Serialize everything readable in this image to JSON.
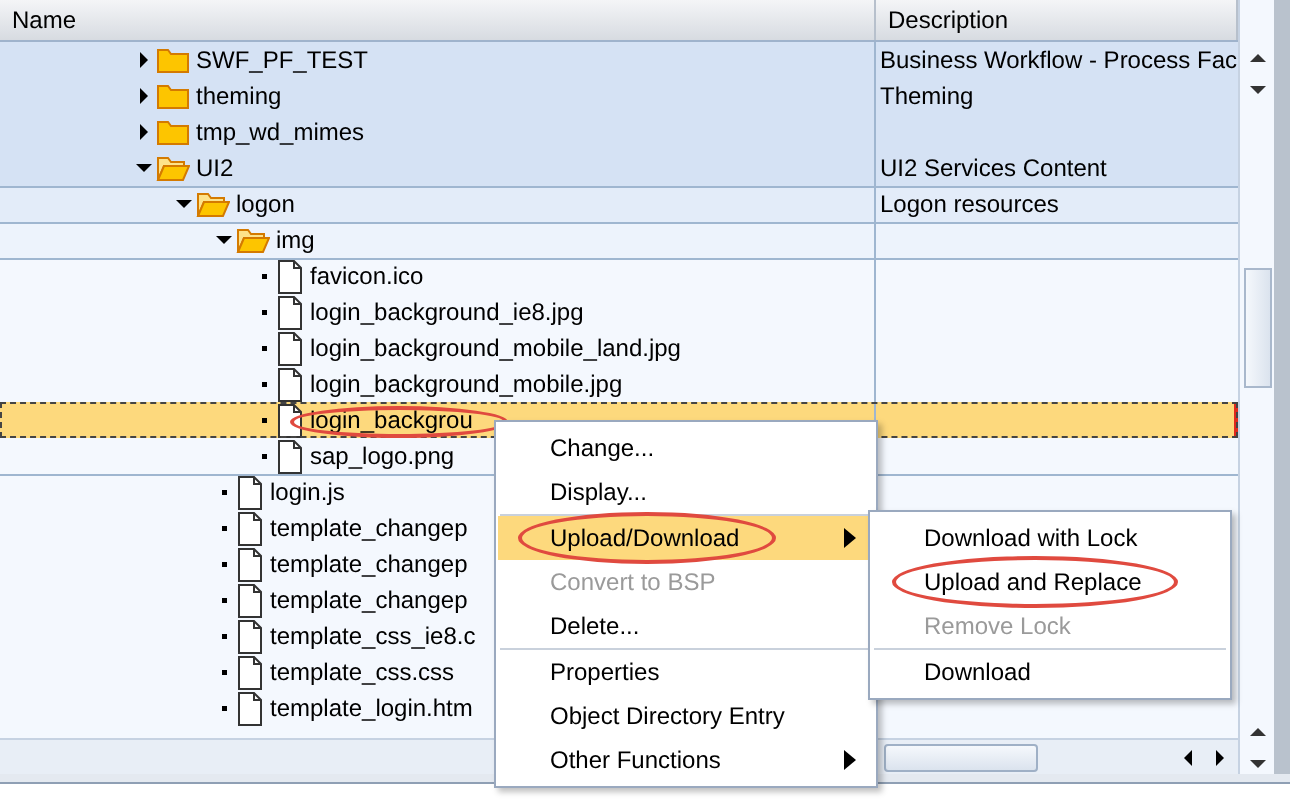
{
  "table": {
    "columns": [
      "Name",
      "Description"
    ]
  },
  "tree": {
    "items": [
      {
        "kind": "folder",
        "name": "SWF_PF_TEST",
        "description": "Business Workflow - Process Fac",
        "expanded": false,
        "selected": false,
        "circled": false
      },
      {
        "kind": "folder",
        "name": "theming",
        "description": "Theming",
        "expanded": false,
        "selected": false,
        "circled": false
      },
      {
        "kind": "folder",
        "name": "tmp_wd_mimes",
        "expanded": false,
        "selected": false,
        "circled": false
      },
      {
        "kind": "folder",
        "name": "UI2",
        "description": "UI2 Services Content",
        "expanded": true,
        "selected": false,
        "circled": false,
        "children": [
          {
            "kind": "folder",
            "name": "logon",
            "description": "Logon resources",
            "expanded": true,
            "selected": false,
            "circled": false,
            "children": [
              {
                "kind": "folder",
                "name": "img",
                "expanded": true,
                "selected": false,
                "circled": false,
                "children": [
                  {
                    "kind": "file",
                    "name": "favicon.ico",
                    "selected": false,
                    "circled": false
                  },
                  {
                    "kind": "file",
                    "name": "login_background_ie8.jpg",
                    "selected": false,
                    "circled": false
                  },
                  {
                    "kind": "file",
                    "name": "login_background_mobile_land.jpg",
                    "selected": false,
                    "circled": false
                  },
                  {
                    "kind": "file",
                    "name": "login_background_mobile.jpg",
                    "selected": false,
                    "circled": false
                  },
                  {
                    "kind": "file",
                    "name": "login_backgrou",
                    "selected": true,
                    "circled": true
                  },
                  {
                    "kind": "file",
                    "name": "sap_logo.png",
                    "selected": false,
                    "circled": false
                  }
                ]
              },
              {
                "kind": "file",
                "name": "login.js",
                "selected": false,
                "circled": false
              },
              {
                "kind": "file",
                "name": "template_changep",
                "selected": false,
                "circled": false
              },
              {
                "kind": "file",
                "name": "template_changep",
                "selected": false,
                "circled": false
              },
              {
                "kind": "file",
                "name": "template_changep",
                "selected": false,
                "circled": false
              },
              {
                "kind": "file",
                "name": "template_css_ie8.c",
                "selected": false,
                "circled": false
              },
              {
                "kind": "file",
                "name": "template_css.css",
                "selected": false,
                "circled": false
              },
              {
                "kind": "file",
                "name": "template_login.htm",
                "selected": false,
                "circled": false
              }
            ]
          }
        ]
      }
    ]
  },
  "context_menu": {
    "items": [
      {
        "label": "Change...",
        "disabled": false,
        "selected": false,
        "submenu": false,
        "divider_above": false,
        "circled": false
      },
      {
        "label": "Display...",
        "disabled": false,
        "selected": false,
        "submenu": false,
        "divider_above": false,
        "circled": false
      },
      {
        "label": "Upload/Download",
        "disabled": false,
        "selected": true,
        "submenu": true,
        "divider_above": true,
        "circled": true
      },
      {
        "label": "Convert to BSP",
        "disabled": true,
        "selected": false,
        "submenu": false,
        "divider_above": false,
        "circled": false
      },
      {
        "label": "Delete...",
        "disabled": false,
        "selected": false,
        "submenu": false,
        "divider_above": false,
        "circled": false
      },
      {
        "label": "Properties",
        "disabled": false,
        "selected": false,
        "submenu": false,
        "divider_above": true,
        "circled": false
      },
      {
        "label": "Object Directory Entry",
        "disabled": false,
        "selected": false,
        "submenu": false,
        "divider_above": false,
        "circled": false
      },
      {
        "label": "Other Functions",
        "disabled": false,
        "selected": false,
        "submenu": true,
        "divider_above": false,
        "circled": false
      }
    ]
  },
  "submenu": {
    "items": [
      {
        "label": "Download with Lock",
        "disabled": false,
        "divider_above": false,
        "circled": false
      },
      {
        "label": "Upload and Replace",
        "disabled": false,
        "divider_above": false,
        "circled": true
      },
      {
        "label": "Remove Lock",
        "disabled": true,
        "divider_above": false,
        "circled": false
      },
      {
        "label": "Download",
        "disabled": false,
        "divider_above": true,
        "circled": false
      }
    ]
  }
}
